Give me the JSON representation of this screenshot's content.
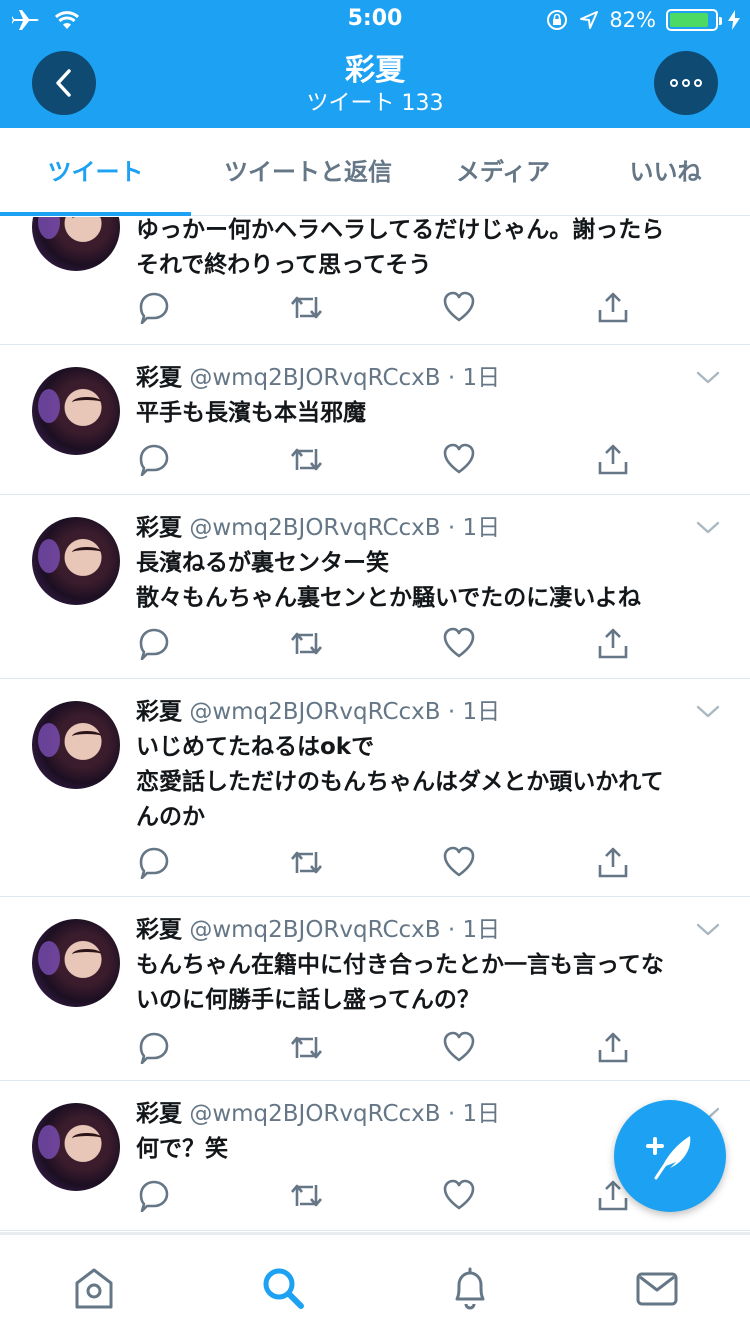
{
  "status_bar": {
    "time": "5:00",
    "battery": "82%",
    "battery_level": 0.82
  },
  "header": {
    "title": "彩夏",
    "subtitle": "ツイート 133"
  },
  "tabs": [
    {
      "label": "ツイート",
      "active": true
    },
    {
      "label": "ツイートと返信",
      "active": false
    },
    {
      "label": "メディア",
      "active": false
    },
    {
      "label": "いいね",
      "active": false
    }
  ],
  "tweets": [
    {
      "name": "",
      "handle": "",
      "time": "",
      "text": "ゆっかー何かヘラヘラしてるだけじゃん。謝ったら\nそれで終わりって思ってそう"
    },
    {
      "name": "彩夏",
      "handle": "@wmq2BJORvqRCcxB",
      "time": "1日",
      "text": "平手も長濱も本当邪魔"
    },
    {
      "name": "彩夏",
      "handle": "@wmq2BJORvqRCcxB",
      "time": "1日",
      "text": "長濱ねるが裏センター笑\n散々もんちゃん裏センとか騒いでたのに凄いよね"
    },
    {
      "name": "彩夏",
      "handle": "@wmq2BJORvqRCcxB",
      "time": "1日",
      "text": "いじめてたねるはokで\n恋愛話しただけのもんちゃんはダメとか頭いかれて\nんのか"
    },
    {
      "name": "彩夏",
      "handle": "@wmq2BJORvqRCcxB",
      "time": "1日",
      "text": "もんちゃん在籍中に付き合ったとか一言も言ってな\nいのに何勝手に話し盛ってんの？"
    },
    {
      "name": "彩夏",
      "handle": "@wmq2BJORvqRCcxB",
      "time": "1日",
      "text": "何で？笑"
    }
  ],
  "colors": {
    "brand": "#1da1f2",
    "header_button": "#0f4a73",
    "secondary_text": "#657786",
    "divider": "#e1e8ed"
  },
  "icons": {
    "status": [
      "airplane-icon",
      "wifi-icon",
      "rotation-lock-icon",
      "location-arrow-icon",
      "battery-icon",
      "charging-icon"
    ],
    "tweet_actions": [
      "reply-icon",
      "retweet-icon",
      "like-icon",
      "share-icon"
    ],
    "bottom_nav": [
      "home-icon",
      "search-icon",
      "notifications-icon",
      "messages-icon"
    ],
    "fab": "compose-tweet-icon"
  }
}
